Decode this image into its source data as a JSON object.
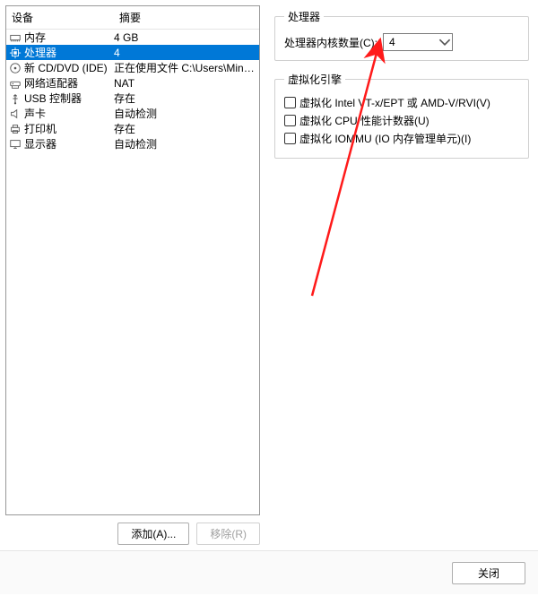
{
  "left": {
    "header_device": "设备",
    "header_summary": "摘要",
    "rows": [
      {
        "icon": "memory-icon",
        "device": "内存",
        "summary": "4 GB",
        "selected": false
      },
      {
        "icon": "cpu-icon",
        "device": "处理器",
        "summary": "4",
        "selected": true
      },
      {
        "icon": "disc-icon",
        "device": "新 CD/DVD (IDE)",
        "summary": "正在使用文件 C:\\Users\\MinC...",
        "selected": false
      },
      {
        "icon": "network-icon",
        "device": "网络适配器",
        "summary": "NAT",
        "selected": false
      },
      {
        "icon": "usb-icon",
        "device": "USB 控制器",
        "summary": "存在",
        "selected": false
      },
      {
        "icon": "sound-icon",
        "device": "声卡",
        "summary": "自动检测",
        "selected": false
      },
      {
        "icon": "printer-icon",
        "device": "打印机",
        "summary": "存在",
        "selected": false
      },
      {
        "icon": "display-icon",
        "device": "显示器",
        "summary": "自动检测",
        "selected": false
      }
    ],
    "add_button": "添加(A)...",
    "remove_button": "移除(R)"
  },
  "right": {
    "processor_group": "处理器",
    "cores_label": "处理器内核数量(C):",
    "cores_value": "4",
    "virt_group": "虚拟化引擎",
    "virt_vtx": "虚拟化 Intel VT-x/EPT 或 AMD-V/RVI(V)",
    "virt_perf": "虚拟化 CPU 性能计数器(U)",
    "virt_iommu": "虚拟化 IOMMU (IO 内存管理单元)(I)"
  },
  "footer": {
    "close_button": "关闭"
  }
}
